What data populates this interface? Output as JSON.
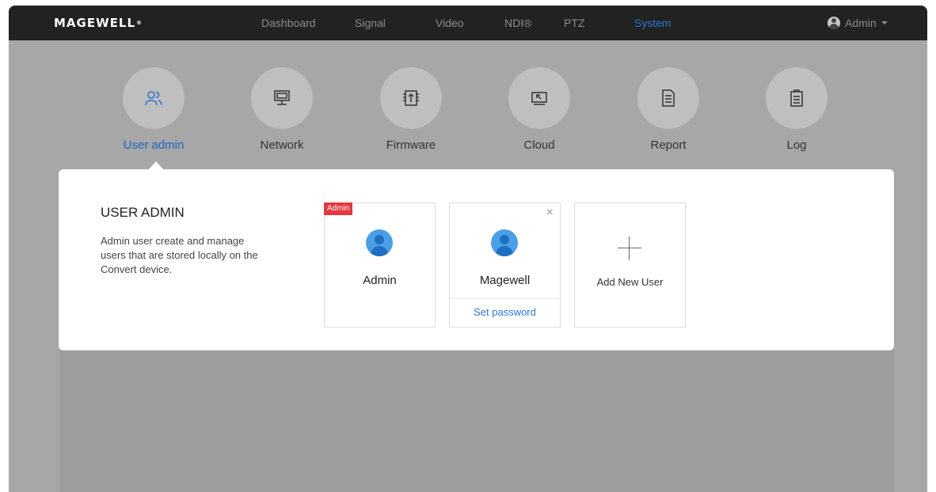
{
  "brand": {
    "logo": "MAGEWELL",
    "registered": "®"
  },
  "nav": {
    "items": [
      "Dashboard",
      "Signal",
      "Video",
      "NDI®",
      "PTZ",
      "System"
    ],
    "active": "System",
    "user_label": "Admin"
  },
  "tiles": [
    {
      "label": "User admin",
      "icon": "users-icon"
    },
    {
      "label": "Network",
      "icon": "monitor-icon"
    },
    {
      "label": "Firmware",
      "icon": "firmware-upload-icon"
    },
    {
      "label": "Cloud",
      "icon": "cloud-screen-icon"
    },
    {
      "label": "Report",
      "icon": "report-document-icon"
    },
    {
      "label": "Log",
      "icon": "clipboard-log-icon"
    }
  ],
  "panel": {
    "title": "USER ADMIN",
    "description": "Admin user create and manage users that are stored locally on the Convert device.",
    "cards": [
      {
        "badge": "Admin",
        "name": "Admin"
      },
      {
        "name": "Magewell",
        "close": "×",
        "action": "Set password"
      },
      {
        "add_label": "Add New User"
      }
    ]
  },
  "colors": {
    "accent": "#2878d8",
    "badge": "#e2383f",
    "topbar": "#222222",
    "overlay": "#a7a7a7"
  }
}
